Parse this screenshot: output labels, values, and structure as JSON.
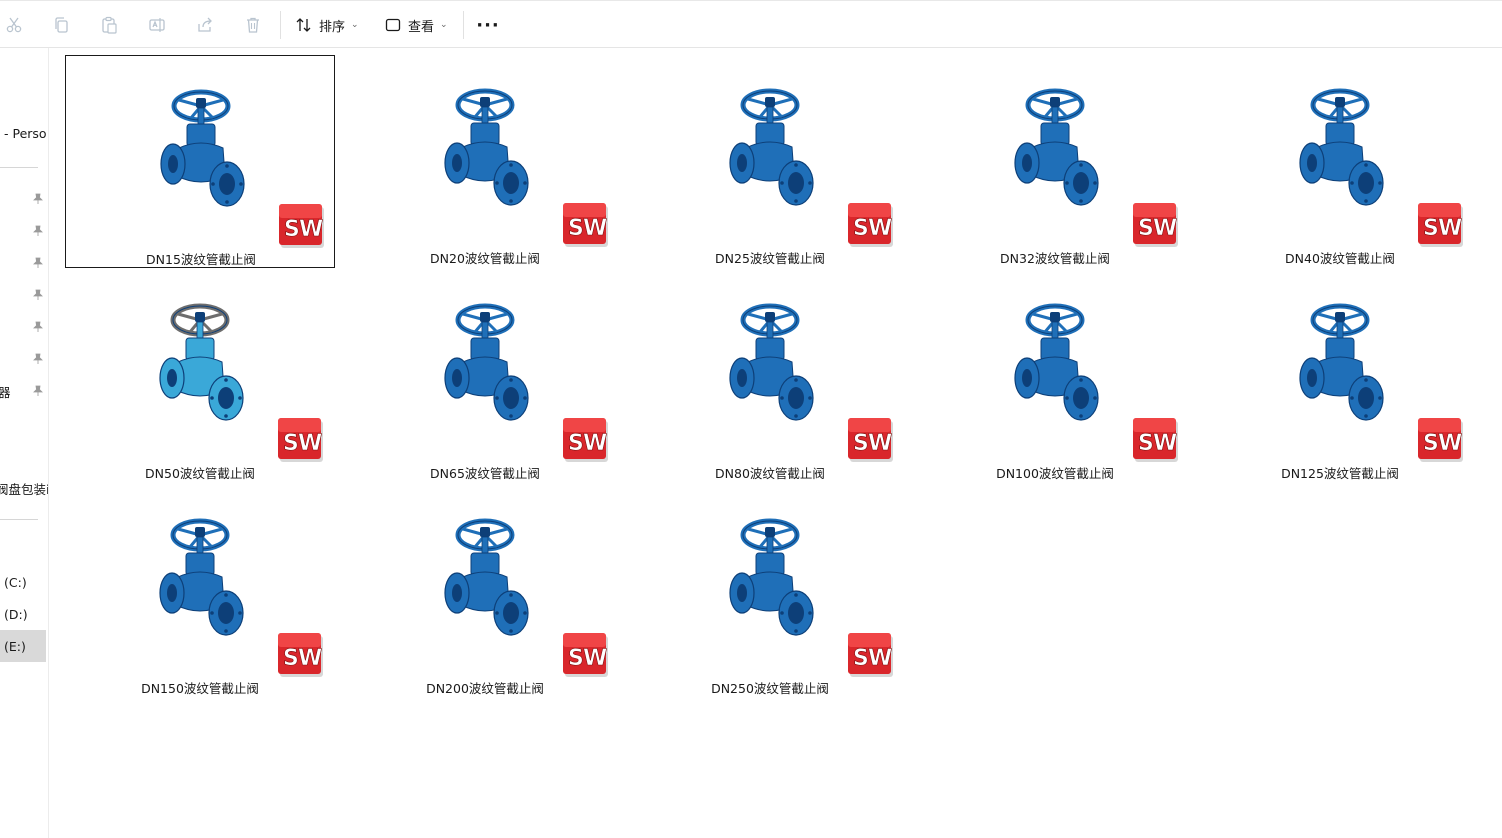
{
  "toolbar": {
    "sort_label": "排序",
    "view_label": "查看",
    "more_label": "···"
  },
  "nav": {
    "partial_items": [
      {
        "label": "- Perso"
      },
      {
        "label": "器"
      },
      {
        "label": "阀盘包装i"
      }
    ],
    "drives": [
      {
        "label": "(C:)"
      },
      {
        "label": "(D:)"
      },
      {
        "label": "(E:)"
      }
    ]
  },
  "files": [
    {
      "name": "DN15波纹管截止阀",
      "type_badge": "SW",
      "selected": true
    },
    {
      "name": "DN20波纹管截止阀",
      "type_badge": "SW"
    },
    {
      "name": "DN25波纹管截止阀",
      "type_badge": "SW"
    },
    {
      "name": "DN32波纹管截止阀",
      "type_badge": "SW"
    },
    {
      "name": "DN40波纹管截止阀",
      "type_badge": "SW"
    },
    {
      "name": "DN50波纹管截止阀",
      "type_badge": "SW"
    },
    {
      "name": "DN65波纹管截止阀",
      "type_badge": "SW"
    },
    {
      "name": "DN80波纹管截止阀",
      "type_badge": "SW"
    },
    {
      "name": "DN100波纹管截止阀",
      "type_badge": "SW"
    },
    {
      "name": "DN125波纹管截止阀",
      "type_badge": "SW"
    },
    {
      "name": "DN150波纹管截止阀",
      "type_badge": "SW"
    },
    {
      "name": "DN200波纹管截止阀",
      "type_badge": "SW"
    },
    {
      "name": "DN250波纹管截止阀",
      "type_badge": "SW"
    }
  ],
  "colors": {
    "valve_blue": "#1f6fb8",
    "valve_dark": "#0d3f78",
    "valve_gray": "#6d6d6d",
    "sw_red": "#d9262b"
  }
}
